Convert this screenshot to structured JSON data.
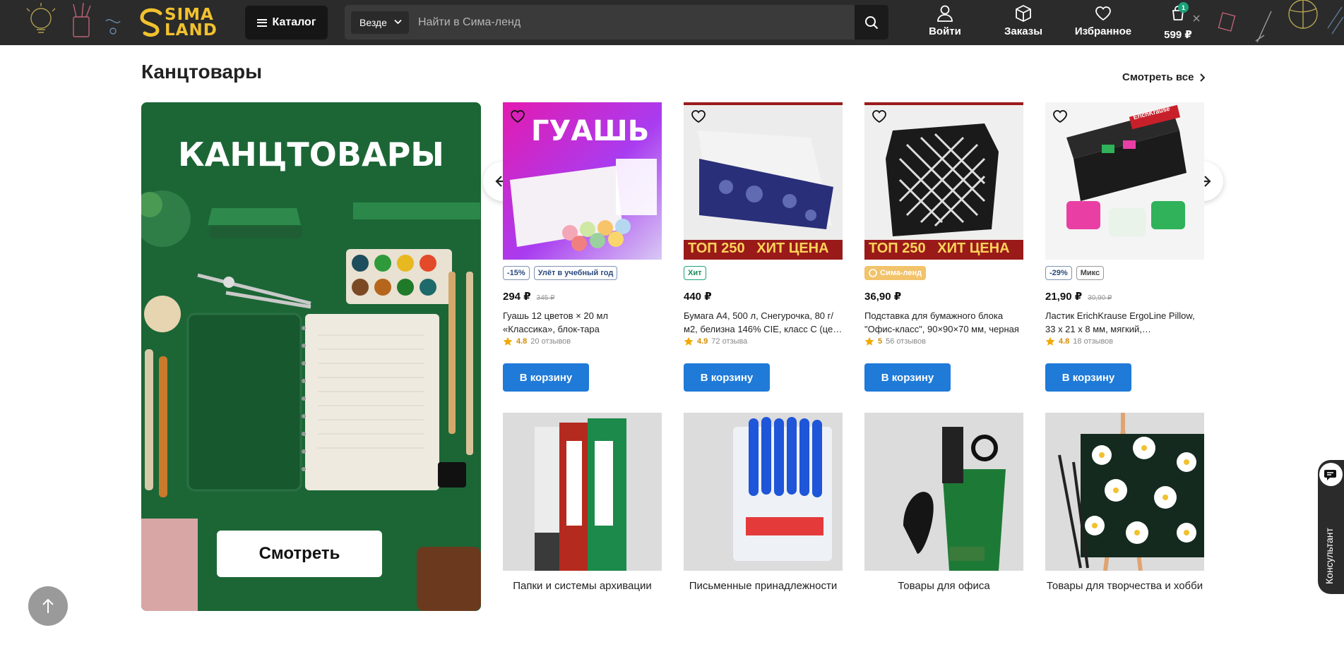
{
  "colors": {
    "header_bg": "#2b2b2b",
    "brand_yellow": "#f2c12e",
    "primary_button": "#1f7ad8",
    "promo_green": "#1f6b3a",
    "hit_green": "#1aa37a",
    "rating": "#d58b00"
  },
  "header": {
    "logo_text_1": "SIMA",
    "logo_text_2": "LAND",
    "catalog_label": "Каталог",
    "search_scope": "Везде",
    "search_placeholder": "Найти в Сима-ленд",
    "login_label": "Войти",
    "orders_label": "Заказы",
    "favorites_label": "Избранное",
    "cart_label": "599 ₽",
    "cart_count": "1"
  },
  "section": {
    "title": "Канцтовары",
    "see_all": "Смотреть все"
  },
  "promo": {
    "title": "КАНЦТОВАРЫ",
    "button": "Смотреть"
  },
  "products": [
    {
      "image_text": "ГУАШЬ",
      "tags": [
        {
          "text": "-15%",
          "style": "blue"
        },
        {
          "text": "Улёт в учебный год",
          "style": "blue"
        }
      ],
      "price": "294 ₽",
      "old_price": "345 ₽",
      "title": "Гуашь 12 цветов × 20 мл «Классика», блок-тара",
      "rating": "4.8",
      "reviews": "20 отзывов",
      "button": "В корзину"
    },
    {
      "image_text": "ТОП 250   ХИТ ЦЕНА",
      "tags": [
        {
          "text": "Хит",
          "style": "green"
        }
      ],
      "price": "440 ₽",
      "old_price": "",
      "title": "Бумага А4, 500 л, Снегурочка, 80 г/м2, белизна 146% CIE, класс C (це…",
      "rating": "4.9",
      "reviews": "72 отзыва",
      "button": "В корзину"
    },
    {
      "image_text": "ТОП 250   ХИТ ЦЕНА",
      "tags": [
        {
          "text": "Сима-ленд",
          "style": "yellow"
        }
      ],
      "price": "36,90 ₽",
      "old_price": "",
      "title": "Подставка для бумажного блока \"Офис-класс\", 90×90×70 мм, черная",
      "rating": "5",
      "reviews": "56 отзывов",
      "button": "В корзину"
    },
    {
      "image_text": "ErichKrause",
      "tags": [
        {
          "text": "-29%",
          "style": "blue"
        },
        {
          "text": "Микс",
          "style": "blue"
        }
      ],
      "price": "21,90 ₽",
      "old_price": "30,90 ₽",
      "title": "Ластик ErichKrause ErgoLine Pillow, 33 x 21 x 8 мм, мягкий,…",
      "rating": "4.8",
      "reviews": "18 отзывов",
      "button": "В корзину"
    }
  ],
  "categories": [
    {
      "label": "Папки и системы архивации"
    },
    {
      "label": "Письменные принадлежности"
    },
    {
      "label": "Товары для офиса"
    },
    {
      "label": "Товары для творчества и хобби"
    }
  ],
  "consultant": {
    "label": "Консультант"
  }
}
